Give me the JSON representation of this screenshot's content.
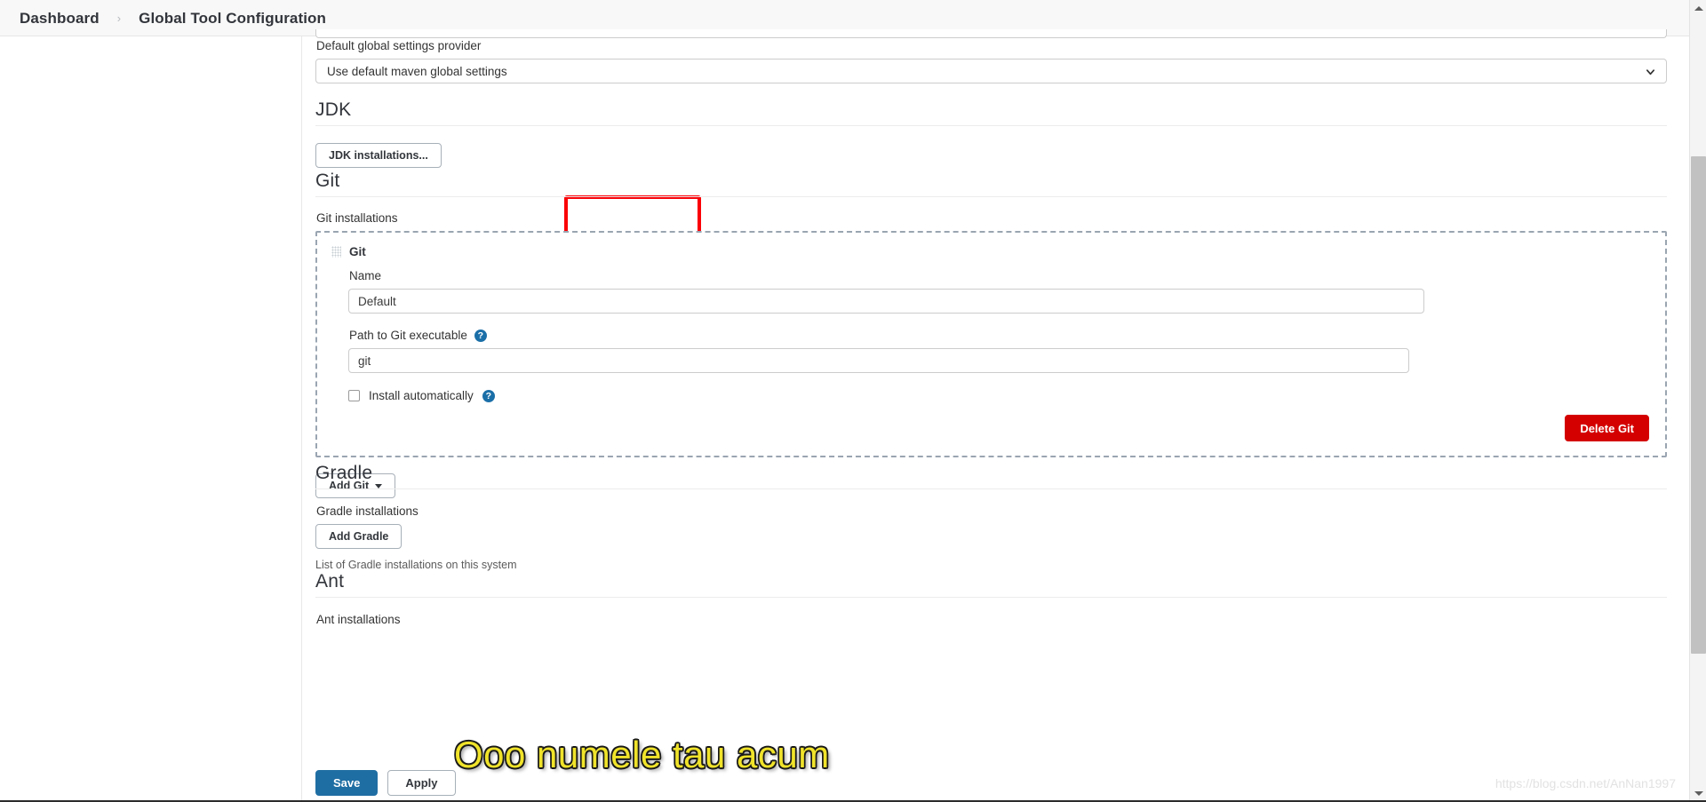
{
  "header": {
    "breadcrumb": [
      {
        "label": "Dashboard"
      },
      {
        "label": "Global Tool Configuration"
      }
    ],
    "separator": "›"
  },
  "maven_section": {
    "default_global_settings_label": "Default global settings provider",
    "default_global_settings_value": "Use default maven global settings",
    "chevron_icon": "chevron-down-icon"
  },
  "jdk_section": {
    "title": "JDK",
    "installations_button": "JDK installations...",
    "highlight_color": "#fb0007"
  },
  "git_section": {
    "title": "Git",
    "installations_label": "Git installations",
    "panel": {
      "drag_handle_icon": "drag-handle-icon",
      "heading": "Git",
      "name_label": "Name",
      "name_value": "Default",
      "path_label": "Path to Git executable",
      "path_help_icon": "help-icon",
      "path_value": "git",
      "install_automatically_label": "Install automatically",
      "install_automatically_checked": false,
      "install_help_icon": "help-icon",
      "delete_button": "Delete Git",
      "delete_button_color": "#d40000"
    },
    "add_button": "Add Git",
    "add_button_caret_icon": "caret-down-icon"
  },
  "gradle_section": {
    "title": "Gradle",
    "installations_label": "Gradle installations",
    "add_button": "Add Gradle",
    "hint": "List of Gradle installations on this system"
  },
  "ant_section": {
    "title": "Ant",
    "installations_label": "Ant installations"
  },
  "bottom_bar": {
    "save_label": "Save",
    "apply_label": "Apply",
    "save_color": "#1f6ea3"
  },
  "overlay": {
    "text": "Ooo numele tau acum",
    "fill_color": "#f0e32a",
    "outline_color": "#1a1a1a"
  },
  "watermark": {
    "text": "https://blog.csdn.net/AnNan1997"
  },
  "scrollbar": {
    "up_icon": "triangle-up-icon",
    "down_icon": "triangle-down-icon",
    "thumb_icon": "scroll-thumb"
  }
}
